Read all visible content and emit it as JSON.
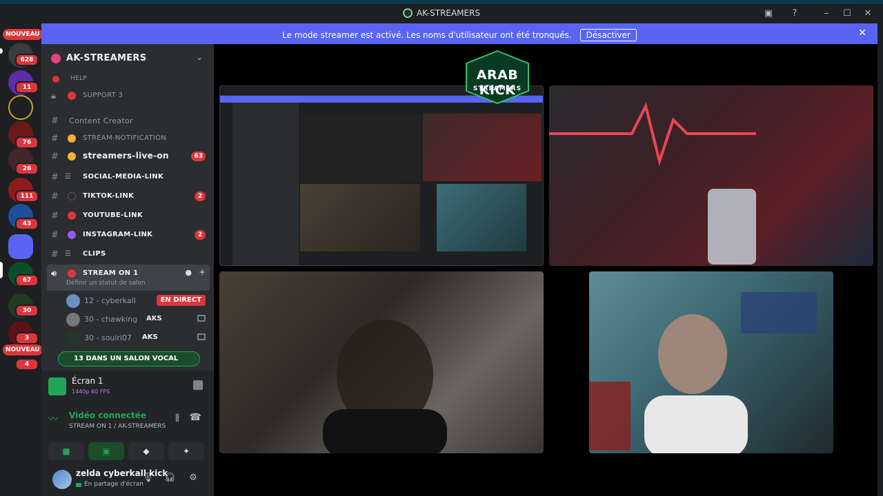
{
  "titlebar": {
    "title": "AK-STREAMERS"
  },
  "banner": {
    "text": "Le mode streamer est activé. Les noms d'utilisateur ont été tronqués.",
    "button": "Désactiver"
  },
  "servers": {
    "badges": [
      "628",
      "11",
      "76",
      "26",
      "111",
      "43",
      "67",
      "30",
      "3",
      "4"
    ],
    "new_labels": [
      "NOUVEAU",
      "NOUVEAU"
    ]
  },
  "guild": {
    "name": "AK-STREAMERS"
  },
  "channels": {
    "help": "HELP",
    "support": "SUPPORT 3",
    "category": "Content Creator",
    "items": [
      {
        "name": "STREAM-NOTIFICATION",
        "count": ""
      },
      {
        "name": "streamers-live-on",
        "count": "63"
      },
      {
        "name": "SOCIAL-MEDIA-LINK",
        "count": ""
      },
      {
        "name": "TIKTOK-LINK",
        "count": "2"
      },
      {
        "name": "YOUTUBE-LINK",
        "count": ""
      },
      {
        "name": "INSTAGRAM-LINK",
        "count": "2"
      },
      {
        "name": "CLIPS",
        "count": ""
      }
    ],
    "voice": {
      "name": "STREAM ON 1",
      "status": "Définir un statut de salon",
      "users": [
        {
          "name": "12 - cyberkall",
          "tag": "",
          "live": "EN DIRECT"
        },
        {
          "name": "30 - chawking",
          "tag": "AKS",
          "live": ""
        },
        {
          "name": "30 - souiri07",
          "tag": "AKS",
          "live": ""
        }
      ],
      "summary": "13 DANS UN SALON VOCAL"
    }
  },
  "panel": {
    "screen_title": "Écran 1",
    "screen_sub": "1440p 60 FPS",
    "conn_title": "Vidéo connectée",
    "conn_sub": "STREAM ON 1 / AK-STREAMERS",
    "user_name": "zelda cyberkall kick",
    "user_status": "En partage d'écran"
  },
  "stage": {
    "logo_text_1": "ARAB KICK",
    "logo_text_2": "STREAMERS"
  },
  "colors": {
    "accent": "#5865f2",
    "live_red": "#da373c",
    "green": "#23a559"
  }
}
